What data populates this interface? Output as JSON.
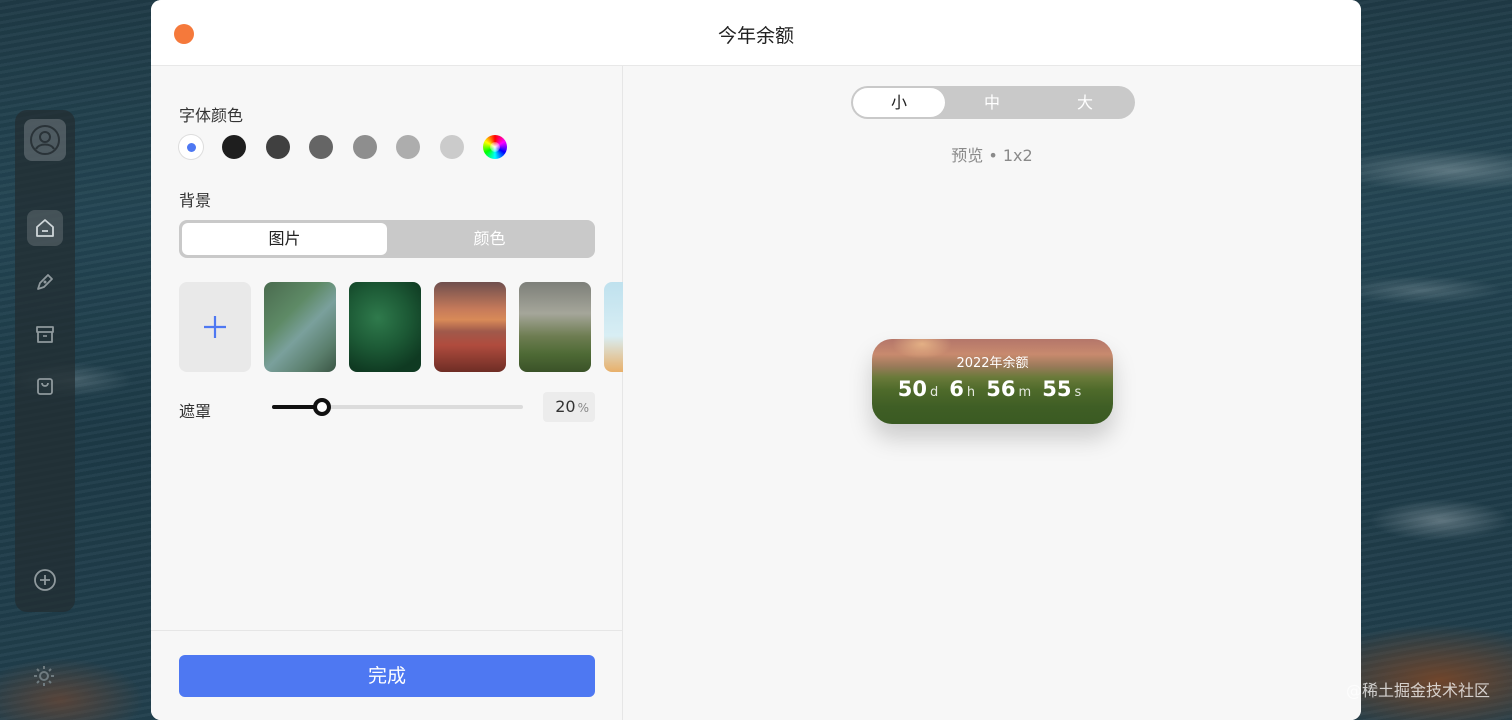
{
  "modal": {
    "title": "今年余额"
  },
  "font_color": {
    "label": "字体颜色",
    "swatches": [
      {
        "name": "blue-selected",
        "color": "#ffffff"
      },
      {
        "name": "black",
        "color": "#1e1e1e"
      },
      {
        "name": "dark-gray",
        "color": "#404040"
      },
      {
        "name": "gray",
        "color": "#656565"
      },
      {
        "name": "mid-gray",
        "color": "#8e8e8e"
      },
      {
        "name": "light-gray",
        "color": "#adadad"
      },
      {
        "name": "lighter-gray",
        "color": "#cbcbcb"
      },
      {
        "name": "custom-rainbow",
        "color": "rainbow"
      }
    ],
    "selected_accent": "#4e78f2"
  },
  "background": {
    "label": "背景",
    "tabs": [
      "图片",
      "颜色"
    ],
    "active_tab": "图片",
    "images": [
      "thumb1",
      "thumb2",
      "thumb3",
      "thumb4",
      "thumb5"
    ]
  },
  "mask": {
    "label": "遮罩",
    "value": "20",
    "unit": "%",
    "fraction": 0.2
  },
  "footer": {
    "done_label": "完成"
  },
  "preview": {
    "sizes": [
      "小",
      "中",
      "大"
    ],
    "active_size": "小",
    "label": "预览 • 1x2",
    "widget": {
      "title": "2022年余额",
      "days": "50",
      "days_unit": "d",
      "hours": "6",
      "hours_unit": "h",
      "minutes": "56",
      "minutes_unit": "m",
      "seconds": "55",
      "seconds_unit": "s"
    }
  },
  "watermark": "@稀土掘金技术社区",
  "colors": {
    "accent": "#4e78f2",
    "close": "#f5793b"
  }
}
